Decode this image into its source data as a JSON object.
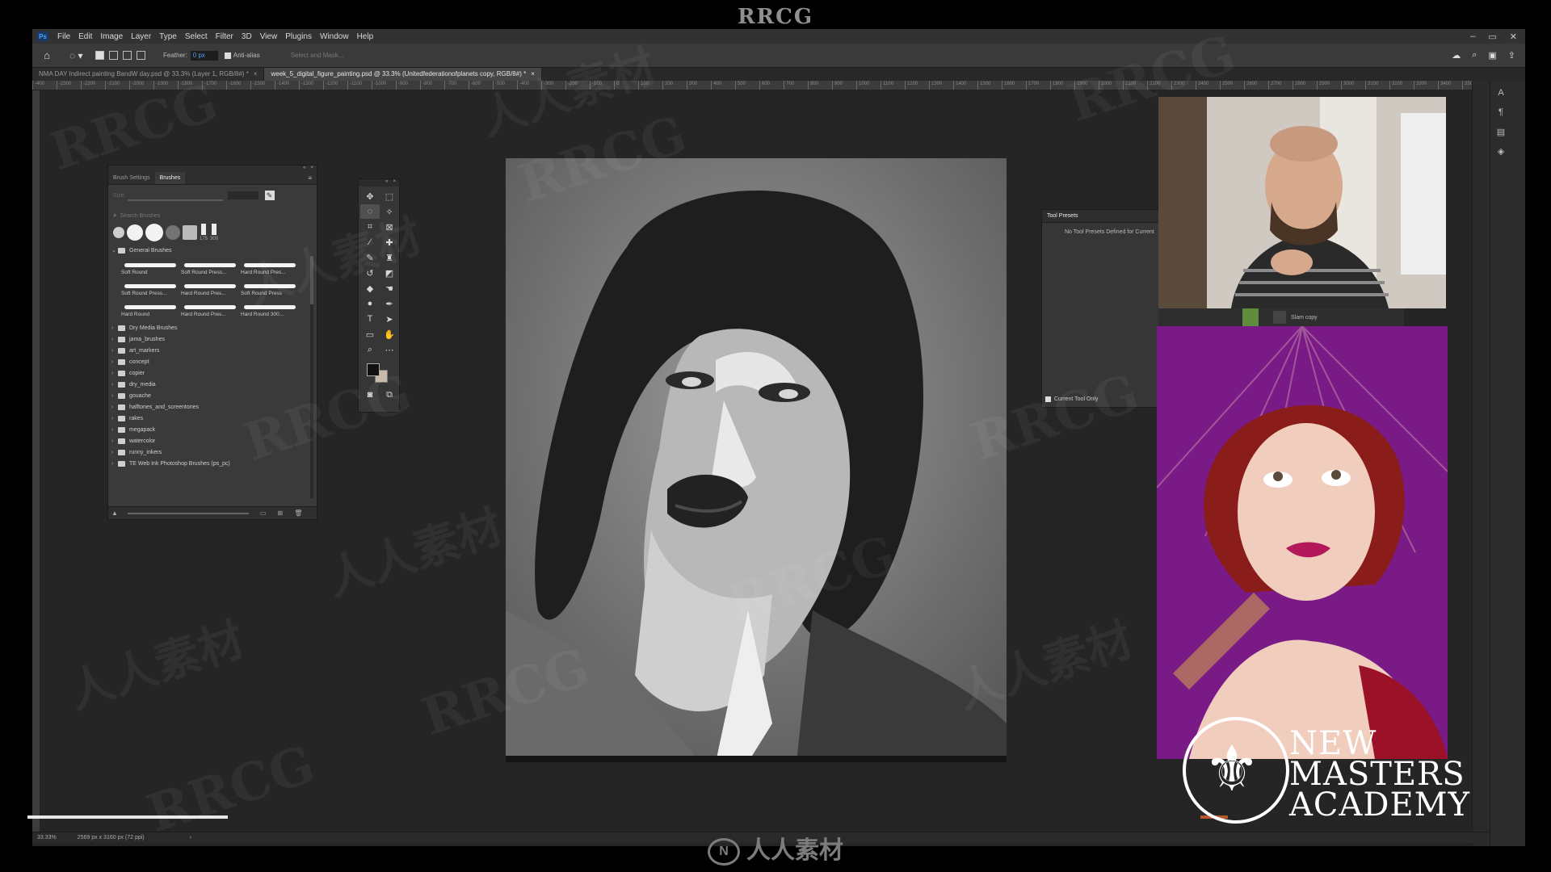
{
  "watermark_top": "RRCG",
  "watermark_bottom": "人人素材",
  "watermark_texts": {
    "rrcg": "RRCG",
    "cn": "人人素材"
  },
  "menu": {
    "logo": "Ps",
    "items": [
      "File",
      "Edit",
      "Image",
      "Layer",
      "Type",
      "Select",
      "Filter",
      "3D",
      "View",
      "Plugins",
      "Window",
      "Help"
    ],
    "window_controls": [
      "–",
      "▭",
      "✕"
    ]
  },
  "options": {
    "feather_label": "Feather:",
    "feather_value": "0 px",
    "antialias_label": "Anti-alias",
    "select_mask": "Select and Mask..."
  },
  "tabs": [
    {
      "label": "NMA DAY Indirect painting BandW day.psd @ 33.3% (Layer 1, RGB/8#) *",
      "close": "×",
      "active": false
    },
    {
      "label": "week_5_digital_figure_painting.psd @ 33.3% (Unitedfederationofplanets copy, RGB/8#) *",
      "close": "×",
      "active": true
    }
  ],
  "ruler_ticks": [
    "-400",
    "-2300",
    "-2200",
    "-2100",
    "-2000",
    "-1900",
    "-1800",
    "-1700",
    "-1600",
    "-1500",
    "-1400",
    "-1300",
    "-1200",
    "-1100",
    "-1000",
    "-900",
    "-800",
    "-700",
    "-600",
    "-500",
    "-400",
    "-300",
    "-200",
    "-100",
    "0",
    "100",
    "200",
    "300",
    "400",
    "500",
    "600",
    "700",
    "800",
    "900",
    "1000",
    "1100",
    "1200",
    "1300",
    "1400",
    "1500",
    "1600",
    "1700",
    "1800",
    "1900",
    "2000",
    "2100",
    "2200",
    "2300",
    "2400",
    "2500",
    "2600",
    "2700",
    "2800",
    "2900",
    "3000",
    "3100",
    "3200",
    "3300",
    "3400",
    "3500",
    "3600",
    "3700",
    "3800",
    "3900",
    "4000",
    "4100",
    "4200",
    "4300",
    "4400",
    "4500",
    "4600",
    "4700",
    "4800"
  ],
  "brushes_panel": {
    "tabs": [
      "Brush Settings",
      "Brushes"
    ],
    "active_tab": "Brushes",
    "size_label": "Size:",
    "search_placeholder": "Search Brushes",
    "recent_sizes": [
      "175",
      "300"
    ],
    "general_group": "General Brushes",
    "general_brushes": [
      "Soft Round",
      "Soft Round Press...",
      "Hard Round Pres...",
      "Soft Round Press...",
      "Hard Round Pres...",
      "Soft Round Press",
      "Hard Round",
      "Hard Round Pres...",
      "Hard Round 300..."
    ],
    "groups": [
      "Dry Media Brushes",
      "jama_brushes",
      "art_markers",
      "concept",
      "copier",
      "dry_media",
      "gouache",
      "halftones_and_screentones",
      "rakes",
      "megapack",
      "watercolor",
      "runny_inkers",
      "TE Web Ink Photoshop Brushes (ps_pc)"
    ]
  },
  "tool_presets": {
    "title": "Tool Presets",
    "message": "No Tool Presets Defined for Current",
    "checkbox_label": "Current Tool Only"
  },
  "webcam": {
    "strip_label": "Slam copy"
  },
  "status": {
    "zoom": "33.33%",
    "dims": "2569 px x 3160 px (72 ppi)",
    "arrow": "›"
  },
  "logo": {
    "lines": [
      "NEW",
      "MASTERS",
      "ACADEMY"
    ]
  },
  "colors": {
    "fg": "#111111",
    "bg": "#c8b9a8",
    "accent": "#4da3ff",
    "ref_bg": "#7a1a86"
  }
}
